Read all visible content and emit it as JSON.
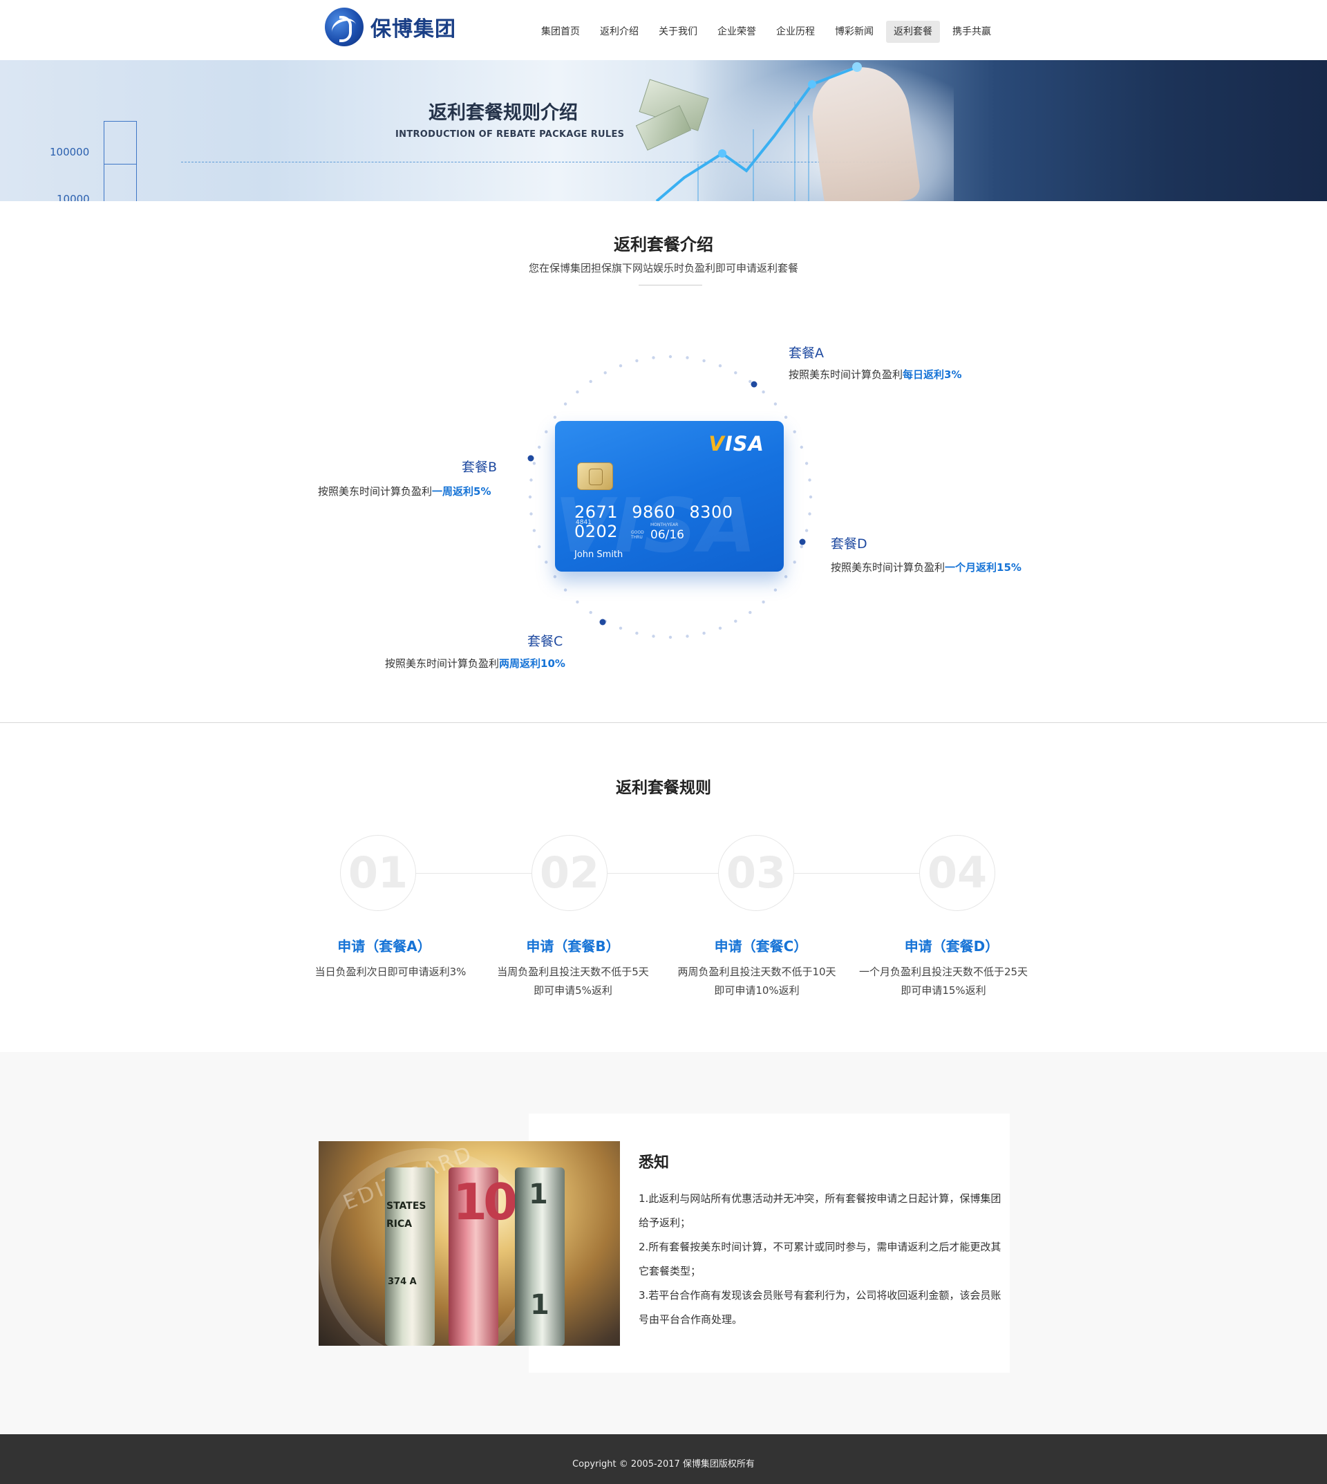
{
  "brand": {
    "name": "保博集团"
  },
  "nav": {
    "items": [
      {
        "label": "集团首页"
      },
      {
        "label": "返利介绍"
      },
      {
        "label": "关于我们"
      },
      {
        "label": "企业荣誉"
      },
      {
        "label": "企业历程"
      },
      {
        "label": "博彩新闻"
      },
      {
        "label": "返利套餐"
      },
      {
        "label": "携手共赢"
      }
    ],
    "active_index": 6
  },
  "banner": {
    "title": "返利套餐规则介绍",
    "subtitle": "INTRODUCTION OF REBATE PACKAGE RULES",
    "axis_value_1": "100000",
    "axis_value_2": "10000"
  },
  "intro": {
    "title": "返利套餐介绍",
    "subtitle": "您在保博集团担保旗下网站娱乐时负盈利即可申请返利套餐",
    "card": {
      "brand": "VISA",
      "number": "2671 9860 8300 0202",
      "small_number": "4841",
      "valid_label": "GOOD THRU",
      "month_year_label": "MONTH/YEAR",
      "expiry": "06/16",
      "holder": "John Smith"
    },
    "packages": [
      {
        "name": "套餐A",
        "desc_prefix": "按照美东时间计算负盈利",
        "highlight": "每日返利3%"
      },
      {
        "name": "套餐B",
        "desc_prefix": "按照美东时间计算负盈利",
        "highlight": "一周返利5%"
      },
      {
        "name": "套餐C",
        "desc_prefix": "按照美东时间计算负盈利",
        "highlight": "两周返利10%"
      },
      {
        "name": "套餐D",
        "desc_prefix": "按照美东时间计算负盈利",
        "highlight": "一个月返利15%"
      }
    ]
  },
  "rules": {
    "title": "返利套餐规则",
    "steps": [
      {
        "num": "01",
        "title": "申请（套餐A）",
        "line1": "当日负盈利次日即可申请返利3%",
        "line2": ""
      },
      {
        "num": "02",
        "title": "申请（套餐B）",
        "line1": "当周负盈利且投注天数不低于5天",
        "line2": "即可申请5%返利"
      },
      {
        "num": "03",
        "title": "申请（套餐C）",
        "line1": "两周负盈利且投注天数不低于10天",
        "line2": "即可申请10%返利"
      },
      {
        "num": "04",
        "title": "申请（套餐D）",
        "line1": "一个月负盈利且投注天数不低于25天",
        "line2": "即可申请15%返利"
      }
    ]
  },
  "notice": {
    "title": "悉知",
    "photo_text": {
      "card_text": "EDIT CARD",
      "bill_ten": "10",
      "bill_one": "1",
      "line_states": "STATES",
      "line_rica": "RICA",
      "line_serial": "374 A"
    },
    "items": [
      "1.此返利与网站所有优惠活动并无冲突，所有套餐按申请之日起计算，保博集团给予返利；",
      "2.所有套餐按美东时间计算，不可累计或同时参与，需申请返利之后才能更改其它套餐类型；",
      "3.若平台合作商有发现该会员账号有套利行为，公司将收回返利金额，该会员账号由平台合作商处理。"
    ]
  },
  "footer": {
    "copyright": "Copyright © 2005-2017 保博集团版权所有"
  },
  "colors": {
    "accent": "#1673d6",
    "package_name": "#1f4aa0",
    "card": "#1672e0",
    "footer_bg": "#333333"
  },
  "icons": {
    "logo": "baobo-logo-icon"
  }
}
